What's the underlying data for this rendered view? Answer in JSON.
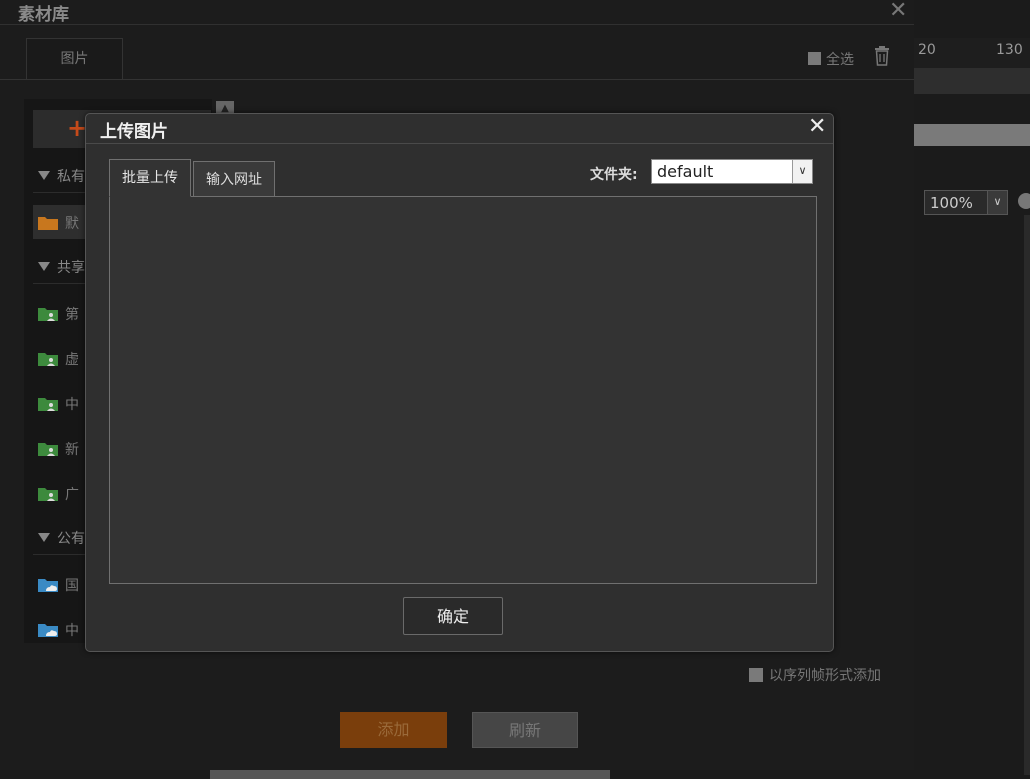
{
  "background_editor": {
    "ruler_labels": [
      "20",
      "130"
    ],
    "zoom_value": "100%"
  },
  "library": {
    "title": "素材库",
    "close_glyph": "✕",
    "tab_label": "图片",
    "select_all_label": "全选",
    "add_glyph": "+",
    "sections": {
      "private": "私有",
      "shared": "共享",
      "public": "公有"
    },
    "folders": {
      "private_default": "默",
      "shared": [
        "第",
        "虚",
        "中",
        "新",
        "广"
      ],
      "public": [
        "国",
        "中"
      ]
    },
    "sequence_label": "以序列帧形式添加",
    "add_button": "添加",
    "refresh_button": "刷新"
  },
  "upload_dialog": {
    "title": "上传图片",
    "close_glyph": "✕",
    "tabs": [
      "批量上传",
      "输入网址"
    ],
    "folder_label": "文件夹:",
    "folder_value": "default",
    "confirm_button": "确定"
  },
  "icons": {
    "close": "close-icon",
    "trash": "trash-icon",
    "folder": "folder-icon",
    "shared_folder": "shared-folder-icon",
    "cloud_folder": "cloud-folder-icon",
    "dropdown": "chevron-down-icon"
  },
  "colors": {
    "accent_orange": "#c54a1a",
    "private_folder": "#c8771e",
    "shared_folder": "#3d8a3d",
    "public_folder": "#3a8ac4"
  }
}
